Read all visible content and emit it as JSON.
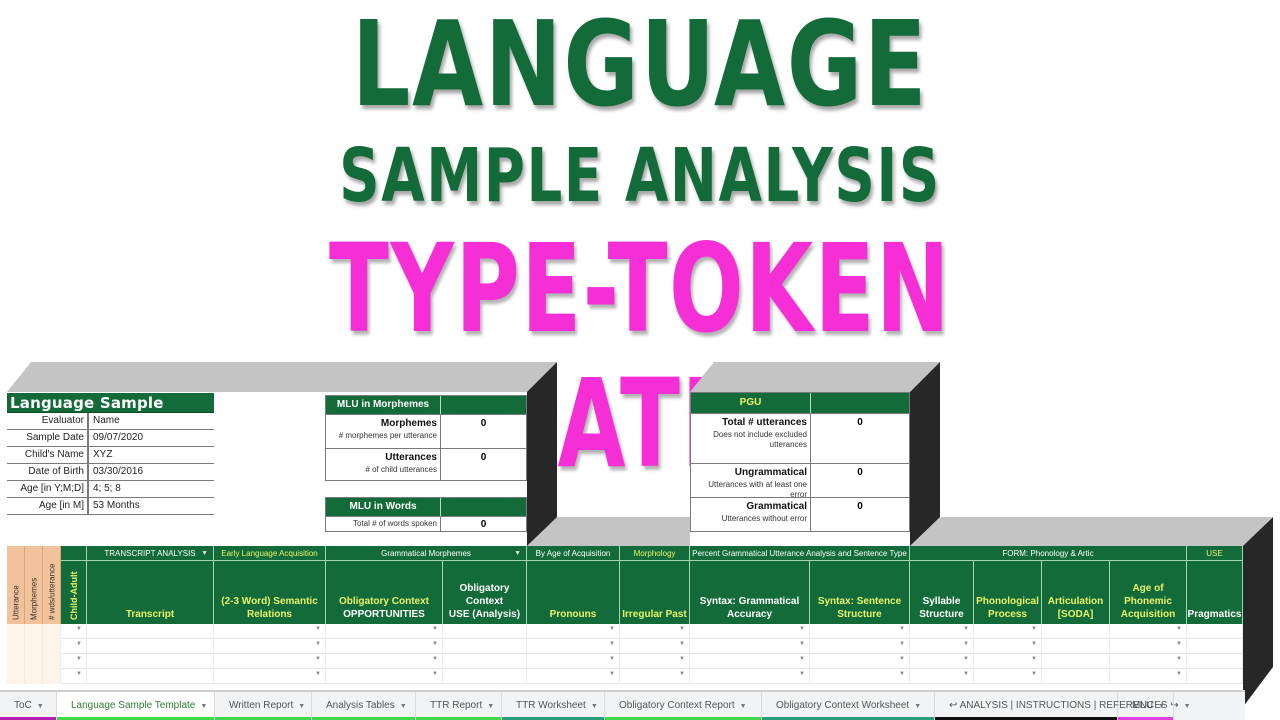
{
  "titles": {
    "line1": "LANGUAGE",
    "line2": "SAMPLE ANALYSIS",
    "line3": "TYPE-TOKEN RATIO",
    "colors": {
      "green": "#146b3a",
      "pink": "#f52ed6"
    }
  },
  "info_panel": {
    "title": "Language Sample Analysis",
    "rows": [
      {
        "label": "Evaluator",
        "value": "Name"
      },
      {
        "label": "Sample Date",
        "value": "09/07/2020"
      },
      {
        "label": "Child's Name",
        "value": "XYZ"
      },
      {
        "label": "Date of Birth",
        "value": "03/30/2016"
      },
      {
        "label": "Age [in Y;M;D]",
        "value": "4; 5; 8"
      },
      {
        "label": "Age [in M]",
        "value": "53 Months"
      }
    ]
  },
  "mlu_morphemes": {
    "header": "MLU in Morphemes",
    "rows": [
      {
        "label": "Morphemes",
        "sub": "# morphemes per utterance",
        "value": "0"
      },
      {
        "label": "Utterances",
        "sub": "# of child utterances",
        "value": "0"
      }
    ]
  },
  "mlu_words": {
    "header": "MLU in Words",
    "rows": [
      {
        "sub": "Total # of words spoken",
        "value": "0"
      }
    ]
  },
  "pgu": {
    "header": "PGU",
    "rows": [
      {
        "label": "Total # utterances",
        "sub": "Does not include excluded utterances",
        "value": "0"
      },
      {
        "label": "Ungrammatical",
        "sub": "Utterances with at least one error",
        "value": "0"
      },
      {
        "label": "Grammatical",
        "sub": "Utterances without error",
        "value": "0"
      }
    ]
  },
  "grid": {
    "vertical_headers": [
      "Utterance",
      "Morphemes",
      "# wds/utterance",
      "Child-Adult"
    ],
    "groups": [
      {
        "label": "TRANSCRIPT ANALYSIS",
        "dropdown": "▼"
      },
      {
        "label": "Early Language Acquisition"
      },
      {
        "label": "Grammatical Morphemes",
        "dropdown": "▼"
      },
      {
        "label": "By Age of Acquisition"
      },
      {
        "label": "Morphology"
      },
      {
        "label": "Percent Grammatical Utterance Analysis and Sentence Type"
      },
      {
        "label": "FORM: Phonology & Artic"
      },
      {
        "label": "USE"
      }
    ],
    "columns": [
      {
        "line1": "Transcript",
        "line2": ""
      },
      {
        "line1": "(2-3 Word) Semantic",
        "line2": "Relations"
      },
      {
        "line1": "Obligatory Context",
        "line2": "OPPORTUNITIES"
      },
      {
        "line1": "Obligatory Context",
        "line2": "USE (Analysis)"
      },
      {
        "line1": "Pronouns",
        "line2": ""
      },
      {
        "line1": "Irregular Past",
        "line2": ""
      },
      {
        "line1": "Syntax: Grammatical",
        "line2": "Accuracy"
      },
      {
        "line1": "Syntax: Sentence",
        "line2": "Structure"
      },
      {
        "line1": "Syllable",
        "line2": "Structure"
      },
      {
        "line1": "Phonological",
        "line2": "Process"
      },
      {
        "line1": "Articulation",
        "line2": "[SODA]"
      },
      {
        "line1": "Age of Phonemic",
        "line2": "Acquisition"
      },
      {
        "line1": "Pragmatics",
        "line2": ""
      }
    ],
    "dropdown_glyph": "▼",
    "empty_rows": 4
  },
  "sheet_tabs": [
    {
      "label": "ToC",
      "color": "#b81fb5"
    },
    {
      "label": "Language Sample Template",
      "color": "#3fd94a",
      "active": true
    },
    {
      "label": "Written Report",
      "color": "#3fd94a"
    },
    {
      "label": "Analysis Tables",
      "color": "#3fd94a"
    },
    {
      "label": "TTR Report",
      "color": "#3fd94a"
    },
    {
      "label": "TTR Worksheet",
      "color": "#2a9d7b"
    },
    {
      "label": "Obligatory Context Report",
      "color": "#3fd94a"
    },
    {
      "label": "Obligatory Context Worksheet",
      "color": "#2a9d7b"
    },
    {
      "label": "↩ ANALYSIS | INSTRUCTIONS | REFERENCES ↪",
      "color": "#111111"
    },
    {
      "label": "MLU",
      "color": "#e040e0"
    }
  ],
  "tab_caret": "▼"
}
